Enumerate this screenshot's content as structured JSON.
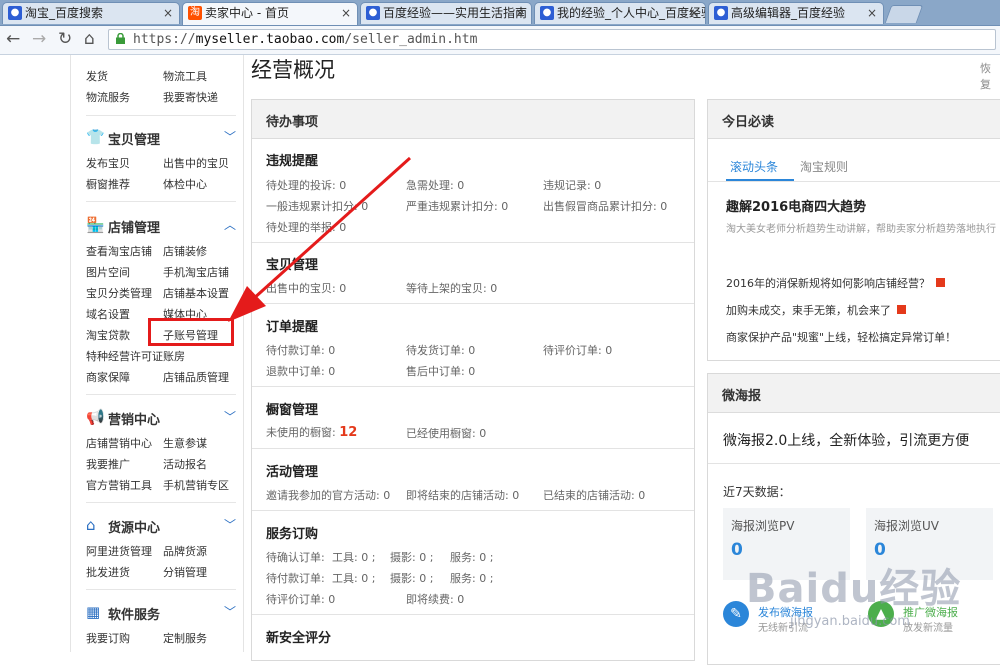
{
  "browser": {
    "tabs": [
      {
        "title": "淘宝_百度搜索",
        "icon": "baidu-paw-icon",
        "active": false
      },
      {
        "title": "卖家中心 - 首页",
        "icon": "taobao-icon",
        "active": true
      },
      {
        "title": "百度经验——实用生活指南",
        "icon": "baidu-paw-icon",
        "active": false
      },
      {
        "title": "我的经验_个人中心_百度经验",
        "icon": "baidu-paw-icon",
        "active": false
      },
      {
        "title": "高级编辑器_百度经验",
        "icon": "baidu-paw-icon",
        "active": false
      }
    ],
    "url_prefix": "https://",
    "url_host": "myseller.taobao.com",
    "url_path": "/seller_admin.htm"
  },
  "sidebar": {
    "top_links": [
      "发货",
      "物流工具",
      "物流服务",
      "我要寄快递"
    ],
    "sections": [
      {
        "title": "宝贝管理",
        "icon": "shirt-icon",
        "chevron": "down",
        "links": [
          "发布宝贝",
          "出售中的宝贝",
          "橱窗推荐",
          "体检中心"
        ]
      },
      {
        "title": "店铺管理",
        "icon": "store-icon",
        "chevron": "up",
        "links": [
          "查看淘宝店铺",
          "店铺装修",
          "图片空间",
          "手机淘宝店铺",
          "宝贝分类管理",
          "店铺基本设置",
          "域名设置",
          "媒体中心",
          "淘宝贷款",
          "子账号管理",
          "特种经营许可证账房",
          "商家保障",
          "店铺品质管理"
        ]
      },
      {
        "title": "营销中心",
        "icon": "megaphone-icon",
        "chevron": "down",
        "links": [
          "店铺营销中心",
          "生意参谋",
          "我要推广",
          "活动报名",
          "官方营销工具",
          "手机营销专区"
        ]
      },
      {
        "title": "货源中心",
        "icon": "home-icon",
        "chevron": "down",
        "links": [
          "阿里进货管理",
          "品牌货源",
          "批发进货",
          "分销管理"
        ]
      },
      {
        "title": "软件服务",
        "icon": "grid-icon",
        "chevron": "down",
        "links": [
          "我要订购",
          "定制服务"
        ]
      }
    ]
  },
  "main": {
    "title": "经营概况",
    "restore_label": "恢复",
    "todo": {
      "header": "待办事项",
      "groups": [
        {
          "title": "违规提醒",
          "items": [
            "待处理的投诉: 0",
            "急需处理: 0",
            "违规记录: 0",
            "一般违规累计扣分: 0",
            "严重违规累计扣分: 0",
            "出售假冒商品累计扣分: 0",
            "待处理的举报: 0"
          ]
        },
        {
          "title": "宝贝管理",
          "items": [
            "出售中的宝贝: 0",
            "等待上架的宝贝: 0"
          ]
        },
        {
          "title": "订单提醒",
          "items": [
            "待付款订单: 0",
            "待发货订单: 0",
            "待评价订单: 0",
            "退款中订单: 0",
            "售后中订单: 0"
          ]
        },
        {
          "title": "橱窗管理",
          "items": [
            "未使用的橱窗:",
            "12",
            "已经使用橱窗: 0"
          ]
        },
        {
          "title": "活动管理",
          "items": [
            "邀请我参加的官方活动: 0",
            "即将结束的店铺活动: 0",
            "已结束的店铺活动: 0"
          ]
        },
        {
          "title": "服务订购",
          "rows": [
            [
              "待确认订单:",
              "工具: 0 ;",
              "摄影: 0 ;",
              "服务: 0 ;"
            ],
            [
              "待付款订单:",
              "工具: 0 ;",
              "摄影: 0 ;",
              "服务: 0 ;"
            ],
            [
              "待评价订单: 0",
              "即将续费: 0"
            ]
          ]
        },
        {
          "title": "新安全评分",
          "items": []
        }
      ]
    }
  },
  "right": {
    "daily": {
      "header": "今日必读",
      "tabs": [
        "滚动头条",
        "淘宝规则"
      ],
      "headline": "趣解2016电商四大趋势",
      "subline": "淘大美女老师分析趋势生动讲解，帮助卖家分析趋势落地执行",
      "news": [
        "2016年的消保新规将如何影响店铺经营？",
        "加购未成交，束手无策，机会来了",
        "商家保护产品\"规蜜\"上线，轻松搞定异常订单！"
      ]
    },
    "haibao": {
      "header": "微海报",
      "banner": "微海报2.0上线，全新体验，引流更方便",
      "recent": "近7天数据：",
      "stats": [
        {
          "label": "海报浏览PV",
          "value": "0"
        },
        {
          "label": "海报浏览UV",
          "value": "0"
        }
      ],
      "actions": [
        {
          "title": "发布微海报",
          "sub": "无线新引流"
        },
        {
          "title": "推广微海报",
          "sub": "放发新流量"
        }
      ]
    }
  },
  "watermark": {
    "main": "Baidu经验",
    "sub": "jingyan.baidu.com"
  },
  "colors": {
    "accent": "#2b6fc2",
    "highlight": "#e41b1b",
    "number": "#2b86d9"
  }
}
